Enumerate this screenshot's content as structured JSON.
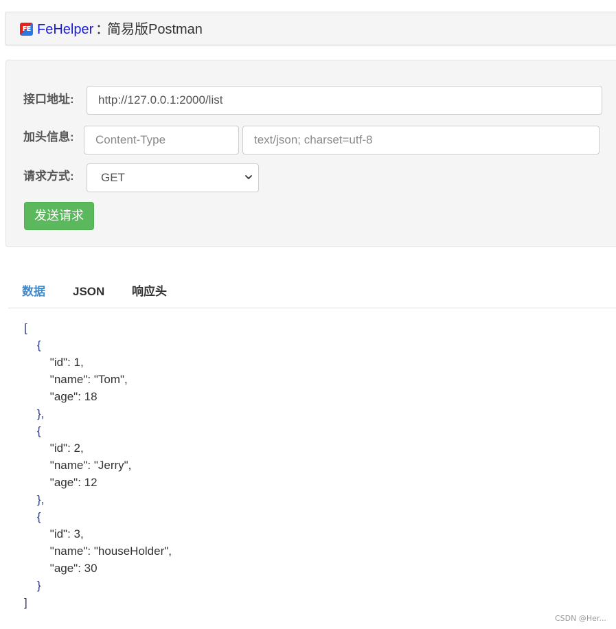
{
  "header": {
    "logo_text": "FE",
    "brand": "FeHelper",
    "separator": "：",
    "title": "简易版Postman"
  },
  "form": {
    "url_label": "接口地址:",
    "url_value": "http://127.0.0.1:2000/list",
    "header_label": "加头信息:",
    "header_key_placeholder": "Content-Type",
    "header_value_placeholder": "text/json; charset=utf-8",
    "method_label": "请求方式:",
    "method_value": "GET",
    "send_label": "发送请求"
  },
  "tabs": [
    {
      "label": "数据",
      "active": true
    },
    {
      "label": "JSON",
      "active": false
    },
    {
      "label": "响应头",
      "active": false
    }
  ],
  "response_lines": [
    "[",
    "    {",
    "        \"id\": 1,",
    "        \"name\": \"Tom\",",
    "        \"age\": 18",
    "    },",
    "    {",
    "        \"id\": 2,",
    "        \"name\": \"Jerry\",",
    "        \"age\": 12",
    "    },",
    "    {",
    "        \"id\": 3,",
    "        \"name\": \"houseHolder\",",
    "        \"age\": 30",
    "    }",
    "]"
  ],
  "watermark": "CSDN @Her...",
  "colors": {
    "send_button": "#5cb85c",
    "active_tab": "#428bca",
    "brand": "#1a1adb",
    "panel_bg": "#f5f5f5"
  }
}
